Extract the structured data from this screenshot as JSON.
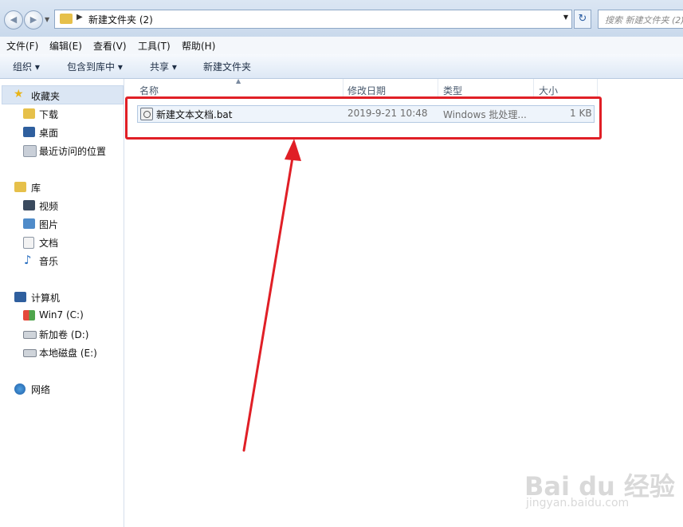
{
  "address_bar": {
    "path": "新建文件夹 (2)",
    "search_placeholder": "搜索 新建文件夹 (2)"
  },
  "menu": [
    "文件(F)",
    "编辑(E)",
    "查看(V)",
    "工具(T)",
    "帮助(H)"
  ],
  "commands": [
    "组织 ▾",
    "包含到库中 ▾",
    "共享 ▾",
    "新建文件夹"
  ],
  "nav": {
    "favorites": {
      "label": "收藏夹",
      "items": [
        "下载",
        "桌面",
        "最近访问的位置"
      ]
    },
    "libraries": {
      "label": "库",
      "items": [
        "视频",
        "图片",
        "文档",
        "音乐"
      ]
    },
    "computer": {
      "label": "计算机",
      "items": [
        "Win7 (C:)",
        "新加卷 (D:)",
        "本地磁盘 (E:)"
      ]
    },
    "network": {
      "label": "网络"
    }
  },
  "columns": [
    "名称",
    "修改日期",
    "类型",
    "大小"
  ],
  "files": [
    {
      "name": "新建文本文档.bat",
      "modified": "2019-9-21 10:48",
      "type": "Windows 批处理...",
      "size": "1 KB"
    }
  ],
  "watermark": {
    "main": "Bai du 经验",
    "sub": "jingyan.baidu.com"
  },
  "annotation_color": "#e01f26"
}
